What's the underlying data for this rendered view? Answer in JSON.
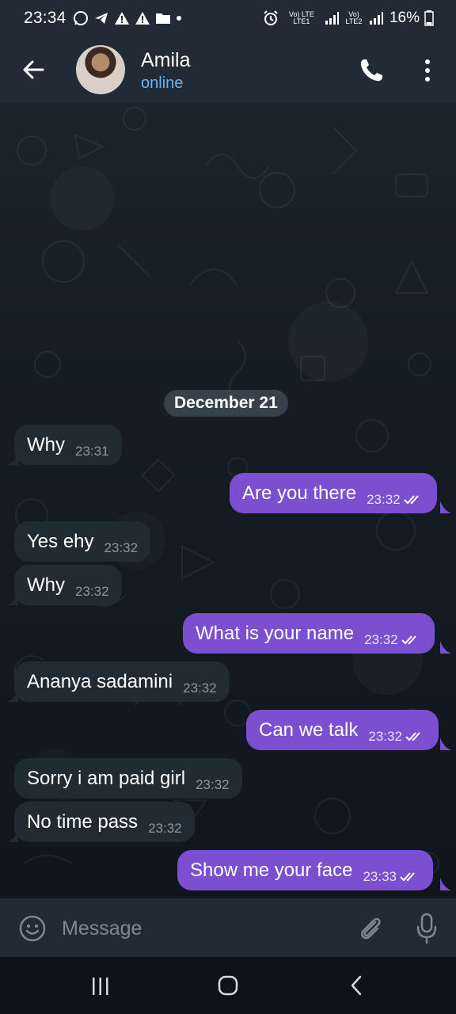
{
  "status_bar": {
    "time": "23:34",
    "net1": "Vo) LTE LTE1",
    "net2": "Vo) LTE2",
    "battery": "16%"
  },
  "header": {
    "contact_name": "Amila",
    "contact_status": "online"
  },
  "chat": {
    "date_separator": "December 21",
    "messages": [
      {
        "direction": "in",
        "text": "Why",
        "time": "23:31"
      },
      {
        "direction": "out",
        "text": "Are you there",
        "time": "23:32",
        "read": true
      },
      {
        "direction": "in",
        "text": "Yes ehy",
        "time": "23:32"
      },
      {
        "direction": "in",
        "text": "Why",
        "time": "23:32"
      },
      {
        "direction": "out",
        "text": "What is your name",
        "time": "23:32",
        "read": true
      },
      {
        "direction": "in",
        "text": "Ananya sadamini",
        "time": "23:32"
      },
      {
        "direction": "out",
        "text": "Can we talk",
        "time": "23:32",
        "read": true
      },
      {
        "direction": "in",
        "text": "Sorry i am paid girl",
        "time": "23:32"
      },
      {
        "direction": "in",
        "text": "No time pass",
        "time": "23:32"
      },
      {
        "direction": "out",
        "text": "Show me your face",
        "time": "23:33",
        "read": true
      }
    ]
  },
  "composer": {
    "placeholder": "Message"
  },
  "colors": {
    "header_bg": "#222b35",
    "outgoing_bubble": "#7c4fd1",
    "incoming_bubble": "#212b34",
    "accent_status": "#6ab3f3"
  },
  "icons": {
    "header": [
      "back-arrow-icon",
      "phone-icon",
      "more-vertical-icon"
    ],
    "composer": [
      "emoji-icon",
      "attach-icon",
      "mic-icon"
    ],
    "nav": [
      "recent-apps-icon",
      "home-icon",
      "nav-back-icon"
    ]
  }
}
